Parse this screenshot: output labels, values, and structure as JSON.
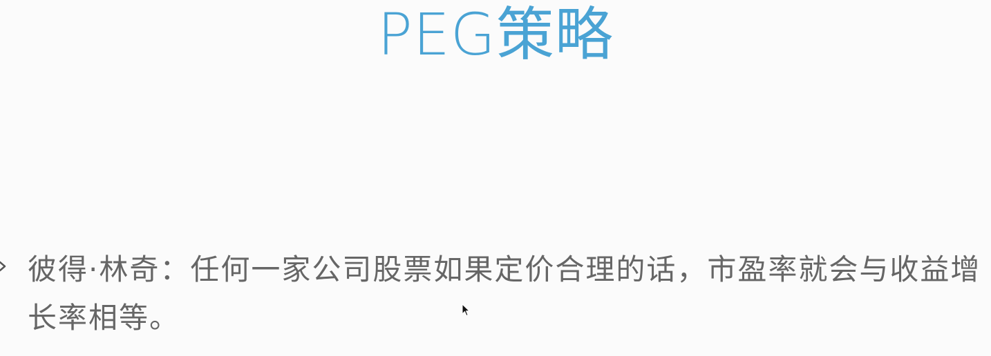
{
  "slide": {
    "title": "PEG策略",
    "bullet_text": "彼得·林奇：任何一家公司股票如果定价合理的话，市盈率就会与收益增长率相等。"
  },
  "colors": {
    "title": "#4aa3d4",
    "body_text": "#666666",
    "bullet": "#555555",
    "background": "#fbfbfb"
  },
  "icons": {
    "bullet": "chevron-right-icon",
    "pointer": "mouse-cursor-icon"
  }
}
